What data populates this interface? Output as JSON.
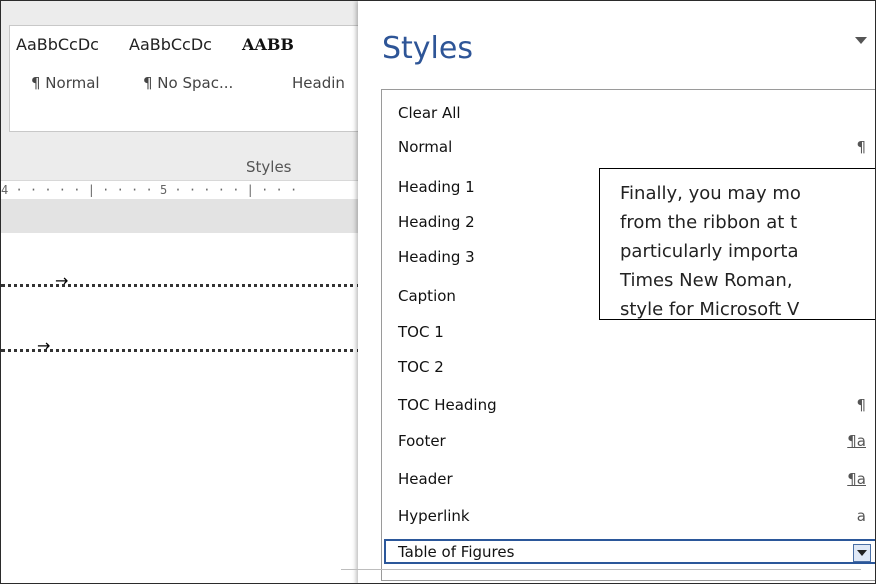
{
  "ribbon": {
    "samples": [
      "AaBbCcDc",
      "AaBbCcDc",
      "AABB"
    ],
    "style_names": [
      "¶ Normal",
      "¶ No Spac...",
      "Headin"
    ],
    "group_label": "Styles",
    "ruler_text": "4 · · · · · | · · · · 5 · · · · · | · · ·"
  },
  "pane": {
    "title": "Styles",
    "menu_icon": "chevron-down-icon",
    "items": [
      {
        "label": "Clear All",
        "mark": ""
      },
      {
        "label": "Normal",
        "mark": "¶"
      },
      {
        "label": "Heading 1",
        "mark": ""
      },
      {
        "label": "Heading 2",
        "mark": ""
      },
      {
        "label": "Heading 3",
        "mark": ""
      },
      {
        "label": "Caption",
        "mark": ""
      },
      {
        "label": "TOC 1",
        "mark": ""
      },
      {
        "label": "TOC 2",
        "mark": ""
      },
      {
        "label": "TOC Heading",
        "mark": "¶"
      },
      {
        "label": "Footer",
        "mark": "¶a"
      },
      {
        "label": "Header",
        "mark": "¶a"
      },
      {
        "label": "Hyperlink",
        "mark": "a"
      },
      {
        "label": "Table of Figures",
        "mark": ""
      }
    ],
    "selected_item": "Table of Figures"
  },
  "callout": {
    "lines": [
      "Finally, you may mo",
      "from the ribbon at t",
      "particularly importa",
      "Times New Roman,",
      "style for Microsoft V"
    ]
  },
  "colors": {
    "accent": "#2e5597",
    "selection_border": "#2b579a"
  }
}
